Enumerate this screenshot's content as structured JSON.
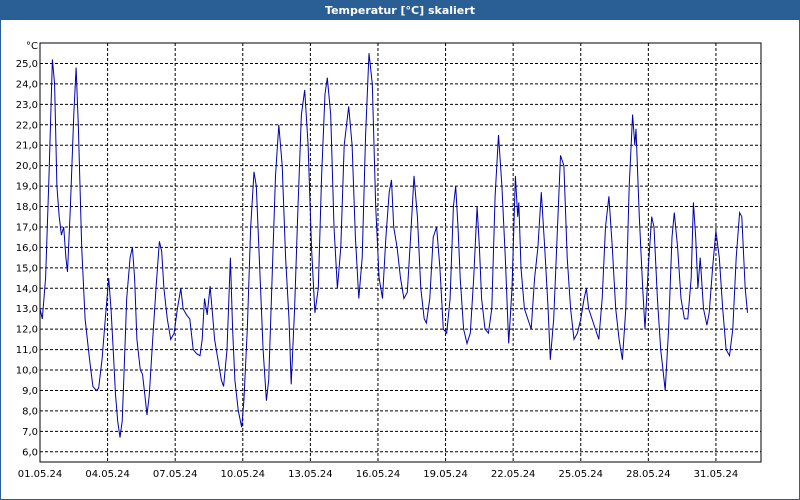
{
  "window": {
    "title": "Temperatur [°C] skaliert"
  },
  "colors": {
    "titlebar": "#2a5f95",
    "line": "#0000b0",
    "grid": "#000000",
    "background": "#ffffff"
  },
  "chart_data": {
    "type": "line",
    "title": "Temperatur [°C] skaliert",
    "ylabel": "°C",
    "xlabel": "",
    "grid": true,
    "xlim": [
      "2024-05-01",
      "2024-06-02"
    ],
    "ylim": [
      5.5,
      26.0
    ],
    "x_tick_labels": [
      "01.05.24",
      "04.05.24",
      "07.05.24",
      "10.05.24",
      "13.05.24",
      "16.05.24",
      "19.05.24",
      "22.05.24",
      "25.05.24",
      "28.05.24",
      "31.05.24"
    ],
    "y_tick_labels": [
      "6,0",
      "7,0",
      "8,0",
      "9,0",
      "10,0",
      "11,0",
      "12,0",
      "13,0",
      "14,0",
      "15,0",
      "16,0",
      "17,0",
      "18,0",
      "19,0",
      "20,0",
      "21,0",
      "22,0",
      "23,0",
      "24,0",
      "25,0"
    ],
    "x_tick_values": [
      0,
      3,
      6,
      9,
      12,
      15,
      18,
      21,
      24,
      27,
      30
    ],
    "y_tick_values": [
      6,
      7,
      8,
      9,
      10,
      11,
      12,
      13,
      14,
      15,
      16,
      17,
      18,
      19,
      20,
      21,
      22,
      23,
      24,
      25
    ],
    "series": [
      {
        "values": [
          [
            0.0,
            13.0
          ],
          [
            0.1,
            12.5
          ],
          [
            0.25,
            14.5
          ],
          [
            0.4,
            19.5
          ],
          [
            0.55,
            25.2
          ],
          [
            0.65,
            24.0
          ],
          [
            0.75,
            19.0
          ],
          [
            0.85,
            17.5
          ],
          [
            0.95,
            16.6
          ],
          [
            1.05,
            17.0
          ],
          [
            1.15,
            15.5
          ],
          [
            1.22,
            14.8
          ],
          [
            1.35,
            18.0
          ],
          [
            1.5,
            22.5
          ],
          [
            1.6,
            24.8
          ],
          [
            1.7,
            22.0
          ],
          [
            1.85,
            16.0
          ],
          [
            2.0,
            12.5
          ],
          [
            2.2,
            10.5
          ],
          [
            2.35,
            9.2
          ],
          [
            2.5,
            9.0
          ],
          [
            2.6,
            9.1
          ],
          [
            2.75,
            10.5
          ],
          [
            2.9,
            12.5
          ],
          [
            3.05,
            14.5
          ],
          [
            3.15,
            13.0
          ],
          [
            3.25,
            11.0
          ],
          [
            3.35,
            8.8
          ],
          [
            3.45,
            7.5
          ],
          [
            3.55,
            6.7
          ],
          [
            3.65,
            7.5
          ],
          [
            3.75,
            10.5
          ],
          [
            3.85,
            13.5
          ],
          [
            4.0,
            15.5
          ],
          [
            4.1,
            16.0
          ],
          [
            4.2,
            14.5
          ],
          [
            4.3,
            11.5
          ],
          [
            4.45,
            10.0
          ],
          [
            4.55,
            9.8
          ],
          [
            4.65,
            8.8
          ],
          [
            4.75,
            7.8
          ],
          [
            4.85,
            8.8
          ],
          [
            5.0,
            11.5
          ],
          [
            5.15,
            14.0
          ],
          [
            5.3,
            16.3
          ],
          [
            5.4,
            15.8
          ],
          [
            5.5,
            14.0
          ],
          [
            5.65,
            12.5
          ],
          [
            5.8,
            11.5
          ],
          [
            5.95,
            11.8
          ],
          [
            6.1,
            13.0
          ],
          [
            6.25,
            14.0
          ],
          [
            6.35,
            13.0
          ],
          [
            6.5,
            12.7
          ],
          [
            6.65,
            12.5
          ],
          [
            6.8,
            11.0
          ],
          [
            6.95,
            10.8
          ],
          [
            7.1,
            10.7
          ],
          [
            7.2,
            11.5
          ],
          [
            7.3,
            13.5
          ],
          [
            7.42,
            12.7
          ],
          [
            7.55,
            14.1
          ],
          [
            7.65,
            12.8
          ],
          [
            7.75,
            11.5
          ],
          [
            7.9,
            10.5
          ],
          [
            8.05,
            9.5
          ],
          [
            8.15,
            9.2
          ],
          [
            8.3,
            11.0
          ],
          [
            8.45,
            15.5
          ],
          [
            8.55,
            12.0
          ],
          [
            8.65,
            9.5
          ],
          [
            8.8,
            8.0
          ],
          [
            8.95,
            7.2
          ],
          [
            9.05,
            8.5
          ],
          [
            9.2,
            12.0
          ],
          [
            9.35,
            17.0
          ],
          [
            9.5,
            19.7
          ],
          [
            9.6,
            19.0
          ],
          [
            9.75,
            15.0
          ],
          [
            9.9,
            11.0
          ],
          [
            10.05,
            8.5
          ],
          [
            10.15,
            9.5
          ],
          [
            10.3,
            14.5
          ],
          [
            10.45,
            19.5
          ],
          [
            10.6,
            22.0
          ],
          [
            10.75,
            20.0
          ],
          [
            10.9,
            15.5
          ],
          [
            11.05,
            12.5
          ],
          [
            11.15,
            9.3
          ],
          [
            11.3,
            13.0
          ],
          [
            11.45,
            18.0
          ],
          [
            11.6,
            22.5
          ],
          [
            11.75,
            23.7
          ],
          [
            11.9,
            21.0
          ],
          [
            12.05,
            16.0
          ],
          [
            12.2,
            12.8
          ],
          [
            12.35,
            14.0
          ],
          [
            12.5,
            19.5
          ],
          [
            12.65,
            23.5
          ],
          [
            12.75,
            24.3
          ],
          [
            12.9,
            22.5
          ],
          [
            13.05,
            17.0
          ],
          [
            13.2,
            14.0
          ],
          [
            13.35,
            16.0
          ],
          [
            13.5,
            21.0
          ],
          [
            13.7,
            22.9
          ],
          [
            13.85,
            21.0
          ],
          [
            14.0,
            16.5
          ],
          [
            14.15,
            13.5
          ],
          [
            14.3,
            15.5
          ],
          [
            14.45,
            21.5
          ],
          [
            14.6,
            25.5
          ],
          [
            14.75,
            24.0
          ],
          [
            14.9,
            18.0
          ],
          [
            15.05,
            14.5
          ],
          [
            15.2,
            13.5
          ],
          [
            15.35,
            16.5
          ],
          [
            15.5,
            18.7
          ],
          [
            15.6,
            19.3
          ],
          [
            15.7,
            17.0
          ],
          [
            15.85,
            16.0
          ],
          [
            16.0,
            14.5
          ],
          [
            16.15,
            13.5
          ],
          [
            16.3,
            13.8
          ],
          [
            16.45,
            16.5
          ],
          [
            16.6,
            19.5
          ],
          [
            16.75,
            17.5
          ],
          [
            16.9,
            14.0
          ],
          [
            17.05,
            12.5
          ],
          [
            17.15,
            12.3
          ],
          [
            17.3,
            13.5
          ],
          [
            17.45,
            16.5
          ],
          [
            17.6,
            17.0
          ],
          [
            17.75,
            15.0
          ],
          [
            17.9,
            12.0
          ],
          [
            18.05,
            11.8
          ],
          [
            18.2,
            13.5
          ],
          [
            18.35,
            18.0
          ],
          [
            18.45,
            19.0
          ],
          [
            18.55,
            17.0
          ],
          [
            18.65,
            14.5
          ],
          [
            18.8,
            12.0
          ],
          [
            18.95,
            11.3
          ],
          [
            19.1,
            11.8
          ],
          [
            19.25,
            14.5
          ],
          [
            19.4,
            18.0
          ],
          [
            19.5,
            16.0
          ],
          [
            19.6,
            13.5
          ],
          [
            19.75,
            12.0
          ],
          [
            19.9,
            11.8
          ],
          [
            20.05,
            13.0
          ],
          [
            20.2,
            18.5
          ],
          [
            20.35,
            21.5
          ],
          [
            20.5,
            19.0
          ],
          [
            20.65,
            15.5
          ],
          [
            20.8,
            11.3
          ],
          [
            20.95,
            14.0
          ],
          [
            21.1,
            19.5
          ],
          [
            21.2,
            17.5
          ],
          [
            21.25,
            18.2
          ],
          [
            21.35,
            15.0
          ],
          [
            21.5,
            13.0
          ],
          [
            21.65,
            12.5
          ],
          [
            21.8,
            12.0
          ],
          [
            21.95,
            14.5
          ],
          [
            22.1,
            16.0
          ],
          [
            22.25,
            18.7
          ],
          [
            22.4,
            16.0
          ],
          [
            22.55,
            13.0
          ],
          [
            22.65,
            10.5
          ],
          [
            22.8,
            12.5
          ],
          [
            22.95,
            16.5
          ],
          [
            23.1,
            20.5
          ],
          [
            23.25,
            20.0
          ],
          [
            23.4,
            15.5
          ],
          [
            23.55,
            13.0
          ],
          [
            23.7,
            11.5
          ],
          [
            23.85,
            11.8
          ],
          [
            24.0,
            12.5
          ],
          [
            24.15,
            13.5
          ],
          [
            24.25,
            14.0
          ],
          [
            24.35,
            13.0
          ],
          [
            24.5,
            12.5
          ],
          [
            24.65,
            12.0
          ],
          [
            24.8,
            11.5
          ],
          [
            24.95,
            13.5
          ],
          [
            25.1,
            17.0
          ],
          [
            25.25,
            18.5
          ],
          [
            25.4,
            16.0
          ],
          [
            25.55,
            13.0
          ],
          [
            25.7,
            11.5
          ],
          [
            25.85,
            10.5
          ],
          [
            26.0,
            13.0
          ],
          [
            26.15,
            19.0
          ],
          [
            26.3,
            22.5
          ],
          [
            26.4,
            21.0
          ],
          [
            26.45,
            21.8
          ],
          [
            26.6,
            17.5
          ],
          [
            26.75,
            14.0
          ],
          [
            26.85,
            12.0
          ],
          [
            27.0,
            15.0
          ],
          [
            27.15,
            17.5
          ],
          [
            27.25,
            17.0
          ],
          [
            27.4,
            13.5
          ],
          [
            27.55,
            11.0
          ],
          [
            27.65,
            10.0
          ],
          [
            27.75,
            9.0
          ],
          [
            27.9,
            12.0
          ],
          [
            28.05,
            16.5
          ],
          [
            28.15,
            17.7
          ],
          [
            28.3,
            16.0
          ],
          [
            28.45,
            13.5
          ],
          [
            28.6,
            12.5
          ],
          [
            28.75,
            12.5
          ],
          [
            28.9,
            14.5
          ],
          [
            29.0,
            18.2
          ],
          [
            29.1,
            16.5
          ],
          [
            29.2,
            14.0
          ],
          [
            29.3,
            15.5
          ],
          [
            29.45,
            13.0
          ],
          [
            29.6,
            12.2
          ],
          [
            29.7,
            12.8
          ],
          [
            29.85,
            15.0
          ],
          [
            30.0,
            16.8
          ],
          [
            30.15,
            15.5
          ],
          [
            30.3,
            13.0
          ],
          [
            30.45,
            11.0
          ],
          [
            30.6,
            10.7
          ],
          [
            30.75,
            12.0
          ],
          [
            30.9,
            15.5
          ],
          [
            31.05,
            17.7
          ],
          [
            31.15,
            17.5
          ],
          [
            31.3,
            14.0
          ],
          [
            31.4,
            12.8
          ]
        ]
      }
    ]
  }
}
